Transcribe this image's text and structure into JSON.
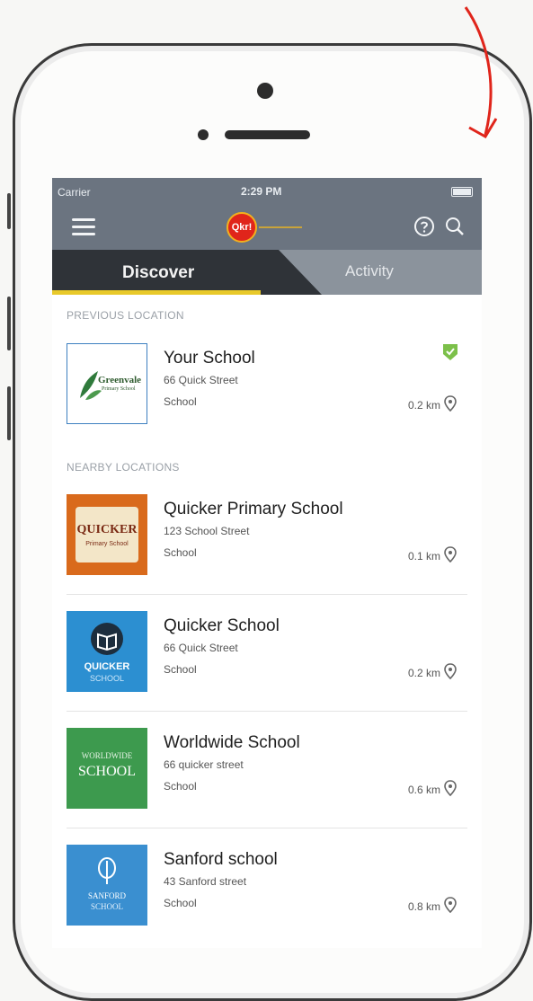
{
  "status_bar": {
    "carrier": "Carrier",
    "time": "2:29 PM"
  },
  "app_bar": {
    "logo_text": "Qkr!"
  },
  "tabs": [
    {
      "label": "Discover",
      "active": true
    },
    {
      "label": "Activity",
      "active": false
    }
  ],
  "sections": {
    "previous": {
      "header": "PREVIOUS LOCATION",
      "item": {
        "name": "Your School",
        "address": "66 Quick Street",
        "type": "School",
        "distance": "0.2 km",
        "logo_text": "Greenvale",
        "logo_subtext": "Primary School",
        "verified": true
      }
    },
    "nearby": {
      "header": "NEARBY LOCATIONS",
      "items": [
        {
          "name": "Quicker Primary School",
          "address": "123 School Street",
          "type": "School",
          "distance": "0.1 km",
          "logo_text": "QUICKER",
          "logo_subtext": "Primary School",
          "logo_bg": "#d96a1c"
        },
        {
          "name": "Quicker School",
          "address": "66 Quick Street",
          "type": "School",
          "distance": "0.2 km",
          "logo_text": "QUICKER",
          "logo_subtext": "SCHOOL",
          "logo_bg": "#2c8fd1"
        },
        {
          "name": "Worldwide School",
          "address": "66 quicker street",
          "type": "School",
          "distance": "0.6 km",
          "logo_text": "WORLDWIDE",
          "logo_subtext": "SCHOOL",
          "logo_bg": "#3d9a4e"
        },
        {
          "name": "Sanford school",
          "address": "43 Sanford street",
          "type": "School",
          "distance": "0.8 km",
          "logo_text": "SANFORD",
          "logo_subtext": "SCHOOL",
          "logo_bg": "#3a8fd0"
        }
      ]
    }
  },
  "colors": {
    "header_bg": "#6b7480",
    "active_tab_bg": "#2f3338",
    "tab_indicator": "#e8c92a",
    "annotation_arrow": "#e0251b",
    "verified_badge": "#7cc04a"
  }
}
